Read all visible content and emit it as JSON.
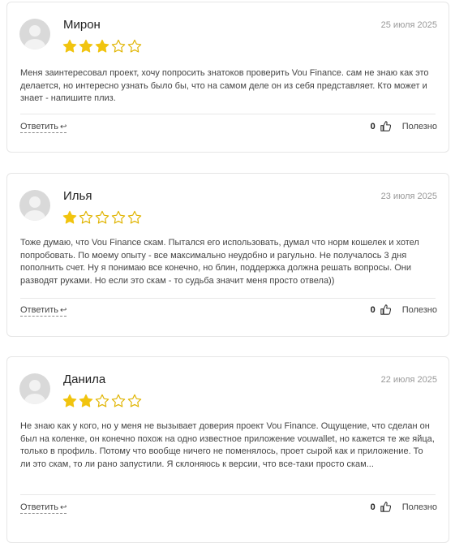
{
  "colors": {
    "star": "#f1c40f",
    "star_empty_stroke": "#e0b400"
  },
  "reviews": [
    {
      "name": "Мирон",
      "date": "25 июля 2025",
      "rating": 3,
      "text": "Меня заинтересовал проект, хочу попросить знатоков проверить Vou Finance. сам не знаю как это делается, но интересно узнать было бы, что на самом деле он из себя представляет. Кто может и знает - напишите плиз.",
      "reply_label": "Ответить",
      "likes": "0",
      "useful_label": "Полезно"
    },
    {
      "name": "Илья",
      "date": "23 июля 2025",
      "rating": 1,
      "text": "Тоже думаю, что Vou Finance скам. Пытался его использовать, думал что норм кошелек и хотел попробовать. По моему опыту - все максимально неудобно и рагульно. Не получалось 3 дня пополнить счет. Ну я понимаю все конечно, но блин, поддержка должна решать вопросы. Они разводят руками. Но если это скам - то судьба значит меня просто отвела))",
      "reply_label": "Ответить",
      "likes": "0",
      "useful_label": "Полезно"
    },
    {
      "name": "Данила",
      "date": "22 июля 2025",
      "rating": 2,
      "text": "Не знаю как у кого, но у меня не вызывает доверия проект Vou Finance. Ощущение, что сделан он был на коленке, он конечно похож на одно известное приложение vouwallet, но кажется те же яйца, только в профиль. Потому что вообще ничего не поменялось, проет сырой как и приложение. То ли это скам, то ли рано запустили. Я склоняюсь к версии, что все-таки просто скам...",
      "reply_label": "Ответить",
      "likes": "0",
      "useful_label": "Полезно"
    }
  ]
}
